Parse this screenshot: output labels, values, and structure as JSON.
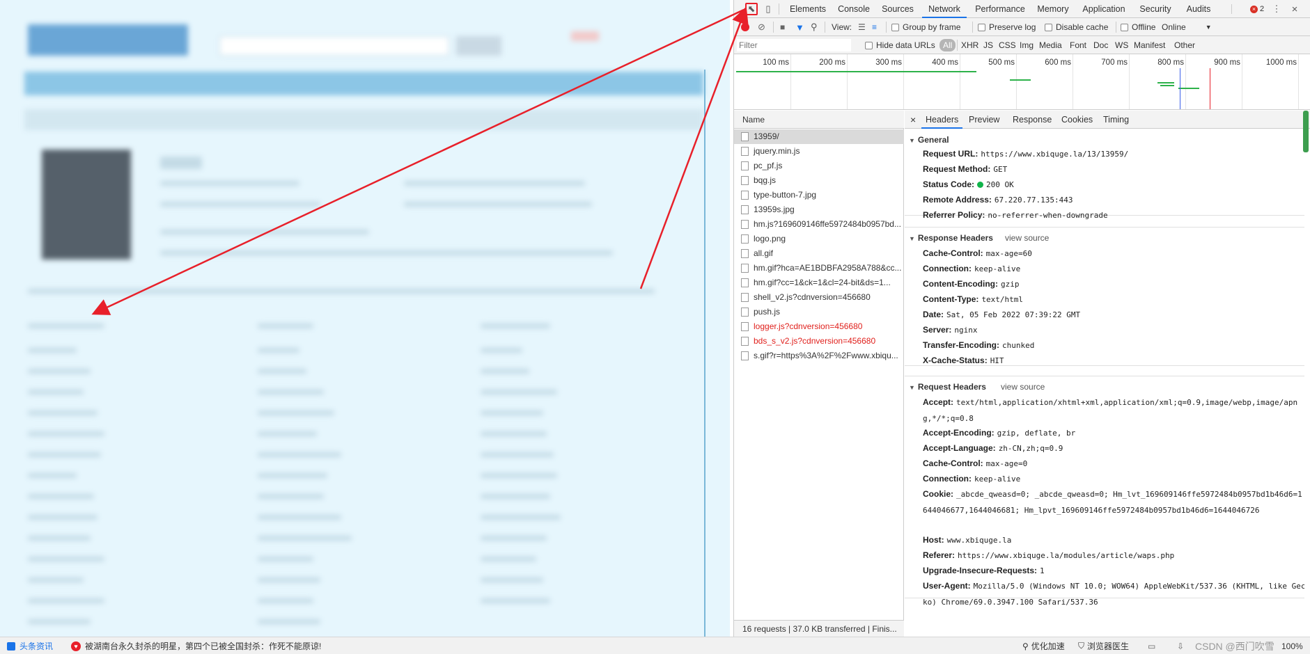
{
  "devtools": {
    "tabs": [
      "Elements",
      "Console",
      "Sources",
      "Network",
      "Performance",
      "Memory",
      "Application",
      "Security",
      "Audits"
    ],
    "active_tab": "Network",
    "error_count": "2"
  },
  "toolbar": {
    "view_label": "View:",
    "group_by_frame": "Group by frame",
    "preserve_log": "Preserve log",
    "disable_cache": "Disable cache",
    "offline": "Offline",
    "throttle": "Online"
  },
  "filter": {
    "placeholder": "Filter",
    "hide_data_urls": "Hide data URLs",
    "types": [
      "All",
      "XHR",
      "JS",
      "CSS",
      "Img",
      "Media",
      "Font",
      "Doc",
      "WS",
      "Manifest",
      "Other"
    ]
  },
  "overview": {
    "ticks": [
      "100 ms",
      "200 ms",
      "300 ms",
      "400 ms",
      "500 ms",
      "600 ms",
      "700 ms",
      "800 ms",
      "900 ms",
      "1000 ms"
    ]
  },
  "list": {
    "header": "Name",
    "rows": [
      {
        "name": "13959/",
        "error": false
      },
      {
        "name": "jquery.min.js",
        "error": false
      },
      {
        "name": "pc_pf.js",
        "error": false
      },
      {
        "name": "bqg.js",
        "error": false
      },
      {
        "name": "type-button-7.jpg",
        "error": false
      },
      {
        "name": "13959s.jpg",
        "error": false
      },
      {
        "name": "hm.js?169609146ffe5972484b0957bd...",
        "error": false
      },
      {
        "name": "logo.png",
        "error": false
      },
      {
        "name": "all.gif",
        "error": false
      },
      {
        "name": "hm.gif?hca=AE1BDBFA2958A788&cc...",
        "error": false
      },
      {
        "name": "hm.gif?cc=1&ck=1&cl=24-bit&ds=1...",
        "error": false
      },
      {
        "name": "shell_v2.js?cdnversion=456680",
        "error": false
      },
      {
        "name": "push.js",
        "error": false
      },
      {
        "name": "logger.js?cdnversion=456680",
        "error": true
      },
      {
        "name": "bds_s_v2.js?cdnversion=456680",
        "error": true
      },
      {
        "name": "s.gif?r=https%3A%2F%2Fwww.xbiqu...",
        "error": false
      }
    ],
    "footer": "16 requests | 37.0 KB transferred | Finis..."
  },
  "detail": {
    "close": "×",
    "tabs": [
      "Headers",
      "Preview",
      "Response",
      "Cookies",
      "Timing"
    ],
    "active_tab": "Headers",
    "view_source": "view source",
    "general": {
      "title": "General",
      "items": [
        {
          "k": "Request URL:",
          "v": "https://www.xbiquge.la/13/13959/"
        },
        {
          "k": "Request Method:",
          "v": "GET"
        },
        {
          "k": "Status Code:",
          "v": "200 OK"
        },
        {
          "k": "Remote Address:",
          "v": "67.220.77.135:443"
        },
        {
          "k": "Referrer Policy:",
          "v": "no-referrer-when-downgrade"
        }
      ]
    },
    "response": {
      "title": "Response Headers",
      "items": [
        {
          "k": "Cache-Control:",
          "v": "max-age=60"
        },
        {
          "k": "Connection:",
          "v": "keep-alive"
        },
        {
          "k": "Content-Encoding:",
          "v": "gzip"
        },
        {
          "k": "Content-Type:",
          "v": "text/html"
        },
        {
          "k": "Date:",
          "v": "Sat, 05 Feb 2022 07:39:22 GMT"
        },
        {
          "k": "Server:",
          "v": "nginx"
        },
        {
          "k": "Transfer-Encoding:",
          "v": "chunked"
        },
        {
          "k": "X-Cache-Status:",
          "v": "HIT"
        }
      ]
    },
    "request": {
      "title": "Request Headers",
      "accept_k": "Accept:",
      "accept_v": "text/html,application/xhtml+xml,application/xml;q=0.9,image/webp,image/apng,*/*;q=0.8",
      "items": [
        {
          "k": "Accept-Encoding:",
          "v": "gzip, deflate, br"
        },
        {
          "k": "Accept-Language:",
          "v": "zh-CN,zh;q=0.9"
        },
        {
          "k": "Cache-Control:",
          "v": "max-age=0"
        },
        {
          "k": "Connection:",
          "v": "keep-alive"
        }
      ],
      "cookie_k": "Cookie:",
      "cookie_v": "_abcde_qweasd=0; _abcde_qweasd=0; Hm_lvt_169609146ffe5972484b0957bd1b46d6=1644046677,1644046681; Hm_lpvt_169609146ffe5972484b0957bd1b46d6=1644046726",
      "items2": [
        {
          "k": "Host:",
          "v": "www.xbiquge.la"
        },
        {
          "k": "Referer:",
          "v": "https://www.xbiquge.la/modules/article/waps.php"
        },
        {
          "k": "Upgrade-Insecure-Requests:",
          "v": "1"
        }
      ],
      "ua_k": "User-Agent:",
      "ua_v": "Mozilla/5.0 (Windows NT 10.0; WOW64) AppleWebKit/537.36 (KHTML, like Gecko) Chrome/69.0.3947.100 Safari/537.36"
    }
  },
  "statusbar": {
    "news_label": "头条资讯",
    "headline": "被湖南台永久封杀的明星，第四个已被全国封杀：作死不能原谅!",
    "speedup": "优化加速",
    "doctor": "浏览器医生",
    "watermark": "CSDN @西门吹雪",
    "zoom": "100%"
  },
  "colors": {
    "accent": "#1a73e8",
    "error": "#e0201c",
    "arrow": "#e8202a",
    "status_ok": "#10b44a"
  }
}
